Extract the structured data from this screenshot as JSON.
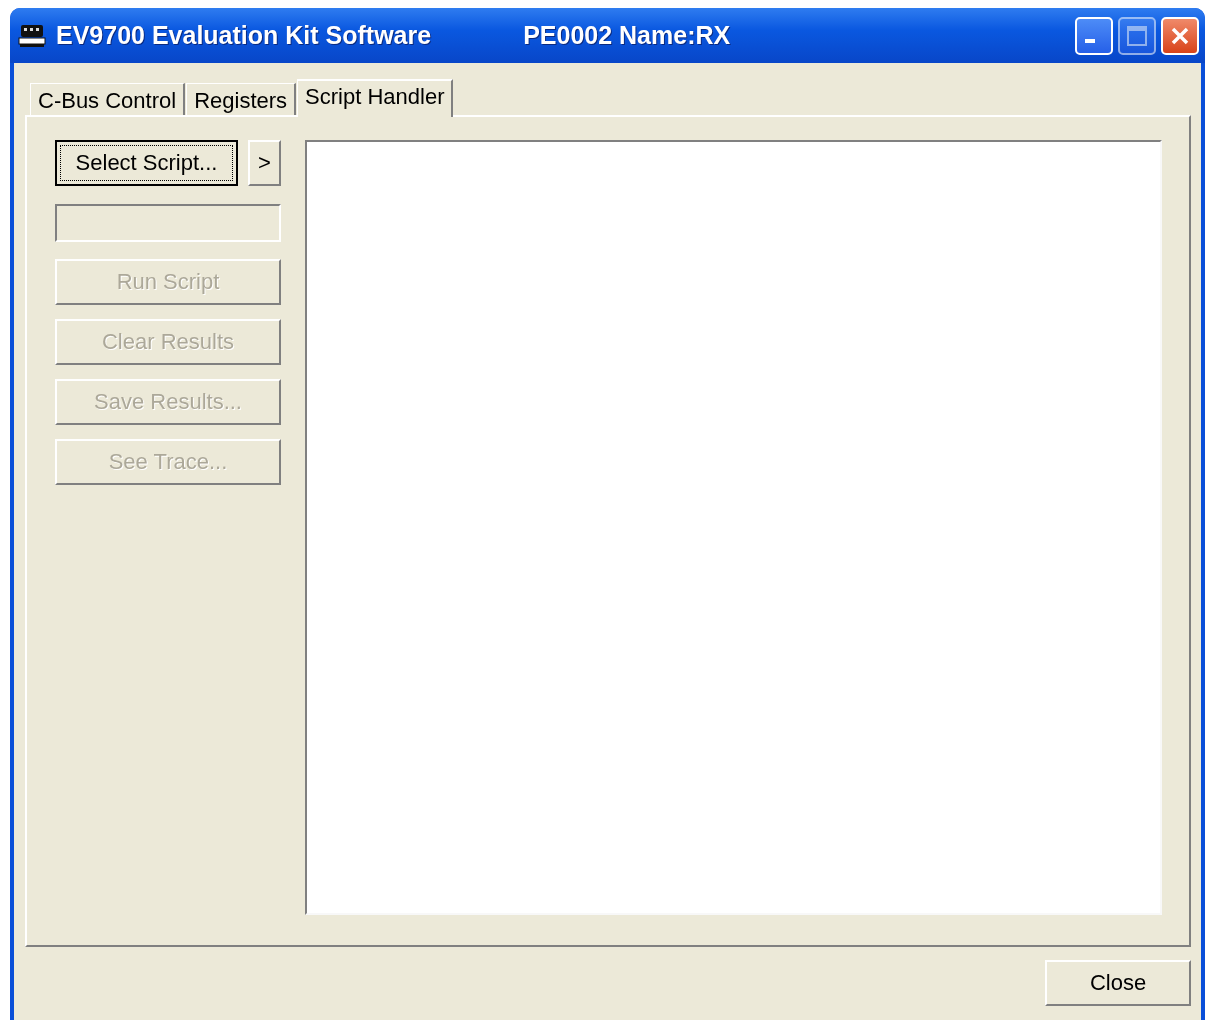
{
  "window": {
    "title": "EV9700 Evaluation Kit Software",
    "subtitle": "PE0002 Name:RX",
    "controls": [
      {
        "kind": "minimize",
        "disabled": false
      },
      {
        "kind": "maximize",
        "disabled": true
      },
      {
        "kind": "close",
        "disabled": false
      }
    ]
  },
  "tabs": [
    {
      "label": "C-Bus Control",
      "selected": false
    },
    {
      "label": "Registers",
      "selected": false
    },
    {
      "label": "Script Handler",
      "selected": true
    }
  ],
  "select_button": {
    "label": "Select Script...",
    "focused": true
  },
  "next_button": {
    "label": ">"
  },
  "buttons": [
    {
      "label": "Run Script",
      "disabled": true
    },
    {
      "label": "Clear Results",
      "disabled": true
    },
    {
      "label": "Save Results...",
      "disabled": true
    },
    {
      "label": "See Trace...",
      "disabled": true
    }
  ],
  "close_button": {
    "label": "Close"
  }
}
